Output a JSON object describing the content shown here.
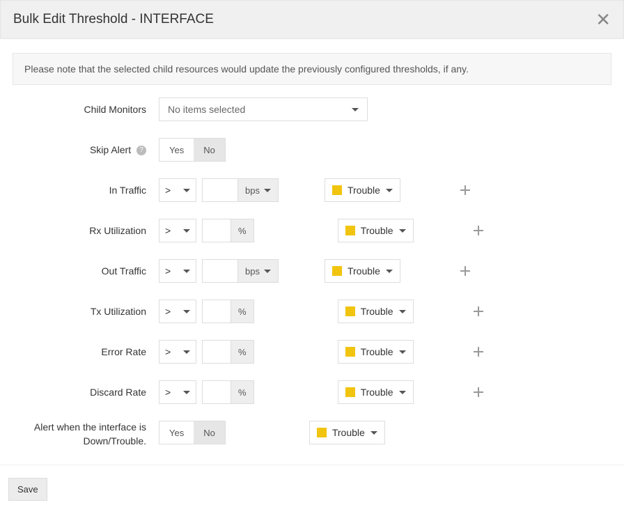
{
  "header": {
    "title": "Bulk Edit Threshold - INTERFACE"
  },
  "notice": "Please note that the selected child resources would update the previously configured thresholds, if any.",
  "labels": {
    "childMonitors": "Child Monitors",
    "skipAlert": "Skip Alert",
    "inTraffic": "In Traffic",
    "rxUtil": "Rx Utilization",
    "outTraffic": "Out Traffic",
    "txUtil": "Tx Utilization",
    "errorRate": "Error Rate",
    "discardRate": "Discard Rate",
    "alertWhenDown": "Alert when the interface is Down/Trouble."
  },
  "childMonitors": {
    "selected": "No items selected"
  },
  "skipAlert": {
    "yes": "Yes",
    "no": "No",
    "value": "No"
  },
  "alertWhenDown": {
    "yes": "Yes",
    "no": "No",
    "value": "No"
  },
  "operator": ">",
  "units": {
    "bps": "bps",
    "pct": "%"
  },
  "status": {
    "label": "Trouble",
    "color": "#f1c40f"
  },
  "footer": {
    "save": "Save"
  }
}
